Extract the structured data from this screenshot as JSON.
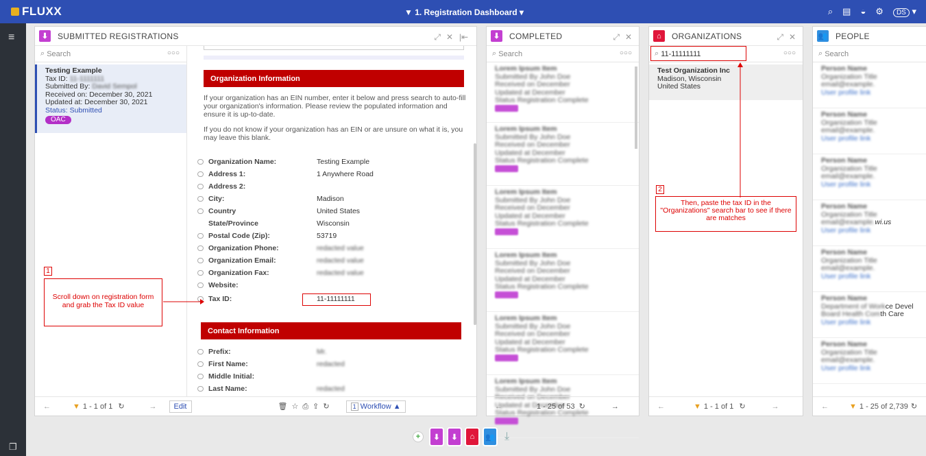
{
  "header": {
    "logo": "FLUXX",
    "dashboard": "1. Registration Dashboard ▾",
    "avatar": "DS"
  },
  "icons": {
    "search": "search-icon",
    "list": "list-icon",
    "chat": "chat-icon",
    "settings": "gear-icon",
    "menu": "hamburger-icon"
  },
  "panels": {
    "submitted": {
      "title": "SUBMITTED REGISTRATIONS",
      "search_placeholder": "Search",
      "dots": "○○○",
      "card": {
        "title": "Testing Example",
        "tax": "Tax ID:",
        "submitted": "Submitted By:",
        "received": "Received on: December 30, 2021",
        "updated": "Updated at: December 30, 2021",
        "status": "Status: Submitted",
        "tag": "OAC"
      },
      "footer": {
        "count": "1 - 1 of 1"
      }
    },
    "detail": {
      "org_header": "Organization Information",
      "para1": "If your organization has an EIN number, enter it below and press search to auto-fill your organization's information. Please review the populated information and ensure it is up-to-date.",
      "para2": "If you do not know if your organization has an EIN or are unsure on what it is, you may leave this blank.",
      "fields": [
        {
          "label": "Organization Name:",
          "value": "Testing Example"
        },
        {
          "label": "Address 1:",
          "value": "1 Anywhere Road"
        },
        {
          "label": "Address 2:",
          "value": ""
        },
        {
          "label": "City:",
          "value": "Madison"
        },
        {
          "label": "Country",
          "value": "United States"
        },
        {
          "label": "State/Province",
          "value": "Wisconsin"
        },
        {
          "label": "Postal Code (Zip):",
          "value": "53719"
        },
        {
          "label": "Organization Phone:",
          "value": ""
        },
        {
          "label": "Organization Email:",
          "value": ""
        },
        {
          "label": "Organization Fax:",
          "value": ""
        },
        {
          "label": "Website:",
          "value": ""
        },
        {
          "label": "Tax ID:",
          "value": "11-11111111"
        }
      ],
      "contact_header": "Contact Information",
      "contact_fields": [
        {
          "label": "Prefix:",
          "value": ""
        },
        {
          "label": "First Name:",
          "value": ""
        },
        {
          "label": "Middle Initial:",
          "value": ""
        },
        {
          "label": "Last Name:",
          "value": ""
        }
      ],
      "footer": {
        "edit": "Edit",
        "workflow": "Workflow ▲",
        "workflow_num": "1"
      }
    },
    "completed": {
      "title": "COMPLETED",
      "search_placeholder": "Search",
      "dots": "○○○",
      "footer": {
        "count": "1 - 25 of 53"
      }
    },
    "organizations": {
      "title": "ORGANIZATIONS",
      "search_value": "11-11111111",
      "dots": "○○○",
      "card": {
        "name": "Test Organization Inc",
        "city": "Madison, Wisconsin",
        "country": "United States"
      },
      "footer": {
        "count": "1 - 1 of 1"
      }
    },
    "people": {
      "title": "PEOPLE",
      "search_placeholder": "Search",
      "footer": {
        "count": "1 - 25 of 2,739"
      },
      "visible_fragments": {
        "f1": "wi.us",
        "f2": "ce Devel",
        "f3": "th Care"
      }
    }
  },
  "annotations": {
    "one": {
      "num": "1",
      "text": "Scroll down on registration form and grab the Tax ID value"
    },
    "two": {
      "num": "2",
      "text": "Then, paste the tax ID in the \"Organizations\" search bar to see if there are matches"
    }
  },
  "colors": {
    "topbar": "#2e4fb3",
    "red": "#c00000",
    "purple": "#b32fc7",
    "magenta": "#c33fd1",
    "orgred": "#e0163a",
    "peopleblue": "#2f8fe0"
  }
}
